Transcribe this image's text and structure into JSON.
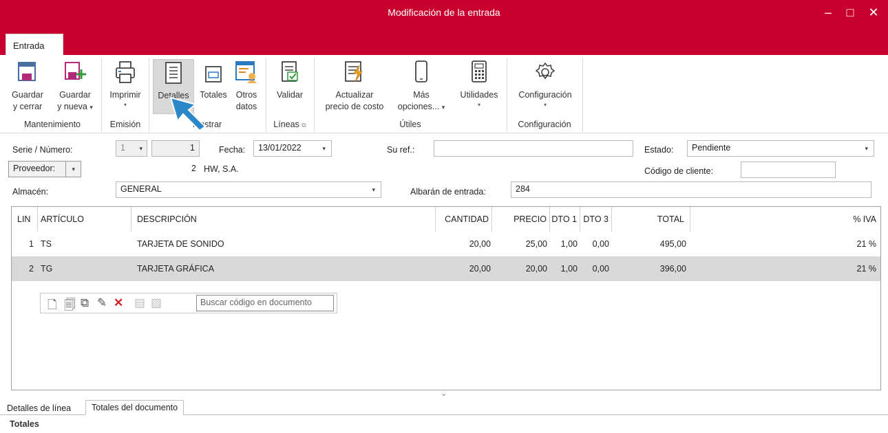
{
  "window": {
    "title": "Modificación de la entrada",
    "minimize_label": "–",
    "maximize_label": "□",
    "close_label": "✕",
    "accent_color": "#c8002e"
  },
  "ribbon": {
    "tab": "Entrada",
    "buttons": {
      "guardar_cerrar": [
        "Guardar",
        "y cerrar"
      ],
      "guardar_nueva": [
        "Guardar",
        "y nueva"
      ],
      "imprimir": "Imprimir",
      "detalles": "Detalles",
      "totales": "Totales",
      "otros_datos": [
        "Otros",
        "datos"
      ],
      "validar": "Validar",
      "actualizar": [
        "Actualizar",
        "precio de costo"
      ],
      "mas_opciones": [
        "Más",
        "opciones..."
      ],
      "utilidades": "Utilidades",
      "configuracion": "Configuración"
    },
    "groups": {
      "mantenimiento": "Mantenimiento",
      "emision": "Emisión",
      "mostrar": "Mostrar",
      "lineas": "Líneas",
      "utiles": "Útiles",
      "configuracion": "Configuración"
    }
  },
  "form": {
    "serie_label": "Serie / Número:",
    "serie_value": "1",
    "numero_value": "1",
    "fecha_label": "Fecha:",
    "fecha_value": "13/01/2022",
    "suref_label": "Su ref.:",
    "suref_value": "",
    "estado_label": "Estado:",
    "estado_value": "Pendiente",
    "proveedor_button": "Proveedor:",
    "proveedor_code": "2",
    "proveedor_name": "HW, S.A.",
    "codigo_cliente_label": "Código de cliente:",
    "codigo_cliente_value": "",
    "almacen_label": "Almacén:",
    "almacen_value": "GENERAL",
    "albaran_label": "Albarán de entrada:",
    "albaran_value": "284"
  },
  "grid": {
    "columns": [
      "LIN",
      "ARTÍCULO",
      "DESCRIPCIÓN",
      "CANTIDAD",
      "PRECIO",
      "DTO 1",
      "DTO 3",
      "TOTAL",
      "% IVA"
    ],
    "rows": [
      {
        "lin": "1",
        "articulo": "TS",
        "descripcion": "TARJETA DE SONIDO",
        "cantidad": "20,00",
        "precio": "25,00",
        "dto1": "1,00",
        "dto3": "0,00",
        "total": "495,00",
        "iva": "21 %"
      },
      {
        "lin": "2",
        "articulo": "TG",
        "descripcion": "TARJETA GRÁFICA",
        "cantidad": "20,00",
        "precio": "20,00",
        "dto1": "1,00",
        "dto3": "0,00",
        "total": "396,00",
        "iva": "21 %"
      }
    ],
    "search_placeholder": "Buscar código en documento"
  },
  "bottom": {
    "tab_detalles": "Detalles de línea",
    "tab_totales": "Totales del documento",
    "section_title": "Totales"
  }
}
